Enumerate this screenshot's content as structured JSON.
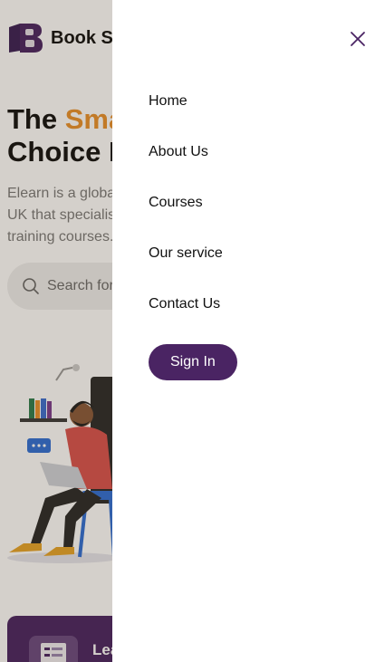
{
  "brand": {
    "name": "Book Store",
    "logo_icon": "book-logo-icon"
  },
  "hero": {
    "title_prefix": "The ",
    "title_accent": "Smart",
    "title_line2": "Choice For Future",
    "description": "Elearn is a global training provider based across the UK that specialises in accredited and bespoke training courses. We crush the"
  },
  "search": {
    "placeholder": "Search for a location...",
    "icon": "search-icon"
  },
  "feature_card": {
    "label": "Learn"
  },
  "drawer": {
    "close_icon": "close-icon",
    "nav": [
      {
        "label": "Home"
      },
      {
        "label": "About Us"
      },
      {
        "label": "Courses"
      },
      {
        "label": "Our service"
      },
      {
        "label": "Contact Us"
      }
    ],
    "signin_label": "Sign In"
  },
  "colors": {
    "primary": "#4a2463",
    "accent": "#e8912d"
  }
}
